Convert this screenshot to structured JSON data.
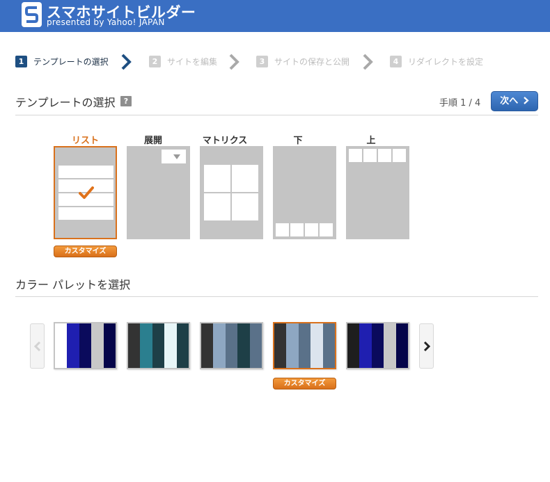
{
  "header": {
    "title": "スマホサイトビルダー",
    "subtitle": "presented by Yahoo! JAPAN",
    "brand_color": "#3a6fc3"
  },
  "steps": [
    {
      "num": "1",
      "label": "テンプレートの選択",
      "state": "active"
    },
    {
      "num": "2",
      "label": "サイトを編集",
      "state": "inactive"
    },
    {
      "num": "3",
      "label": "サイトの保存と公開",
      "state": "inactive"
    },
    {
      "num": "4",
      "label": "リダイレクトを設定",
      "state": "inactive"
    }
  ],
  "template_section": {
    "title": "テンプレートの選択",
    "help_label": "?",
    "step_counter": "手順 1 / 4",
    "next_label": "次へ",
    "templates": [
      {
        "label": "リスト",
        "selected": true
      },
      {
        "label": "展開",
        "selected": false
      },
      {
        "label": "マトリクス",
        "selected": false
      },
      {
        "label": "下",
        "selected": false
      },
      {
        "label": "上",
        "selected": false
      }
    ],
    "customize_label": "カスタマイズ"
  },
  "palette_section": {
    "title": "カラー パレットを選択",
    "customize_label": "カスタマイズ",
    "palettes": [
      {
        "colors": [
          "#ffffff",
          "#1f1fb0",
          "#0a0a5c",
          "#c8c8c8",
          "#05054a"
        ],
        "selected": false
      },
      {
        "colors": [
          "#333333",
          "#2b7f8f",
          "#1e3f47",
          "#e8f6f8",
          "#1e3f47"
        ],
        "selected": false
      },
      {
        "colors": [
          "#333333",
          "#8ea7c2",
          "#5a7189",
          "#1e3f47",
          "#5a7189"
        ],
        "selected": false
      },
      {
        "colors": [
          "#333333",
          "#8ea7c2",
          "#5a7189",
          "#dce4ee",
          "#5a7189"
        ],
        "selected": true
      },
      {
        "colors": [
          "#1e1e1e",
          "#1f1fb0",
          "#0a0a5c",
          "#c8c8c8",
          "#05054a"
        ],
        "selected": false
      }
    ]
  },
  "colors": {
    "accent_orange": "#d9711c",
    "step_active": "#1e4f82",
    "next_button": "#3a76c4"
  }
}
